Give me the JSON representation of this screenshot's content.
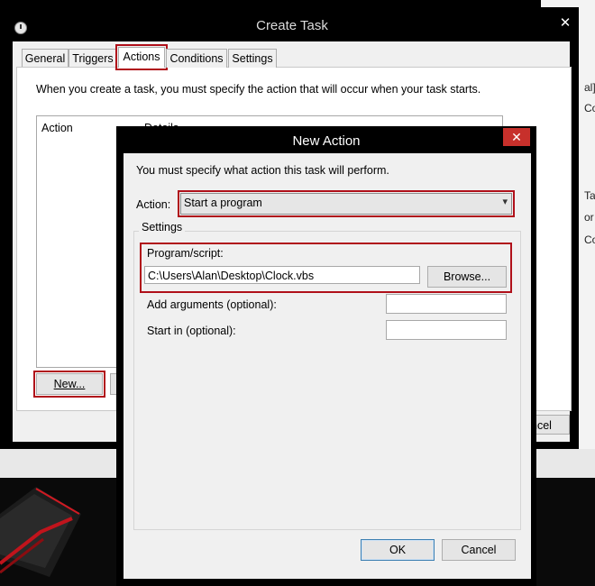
{
  "create_task": {
    "title": "Create Task",
    "close_glyph": "✕",
    "tabs": [
      {
        "label": "General"
      },
      {
        "label": "Triggers"
      },
      {
        "label": "Actions"
      },
      {
        "label": "Conditions"
      },
      {
        "label": "Settings"
      }
    ],
    "active_tab": "Actions",
    "description": "When you create a task, you must specify the action that will occur when your task starts.",
    "columns": {
      "action": "Action",
      "details": "Details"
    },
    "new_button": "New...",
    "cancel_button_partial": "ncel"
  },
  "new_action": {
    "title": "New Action",
    "close_glyph": "✕",
    "intro": "You must specify what action this task will perform.",
    "action_label": "Action:",
    "action_value": "Start a program",
    "settings_label": "Settings",
    "program_label": "Program/script:",
    "program_value": "C:\\Users\\Alan\\Desktop\\Clock.vbs",
    "browse_button": "Browse...",
    "args_label": "Add arguments (optional):",
    "args_value": "",
    "startin_label": "Start in (optional):",
    "startin_value": "",
    "ok_button": "OK",
    "cancel_button": "Cancel"
  },
  "background": {
    "fragments": [
      "al]",
      "Co",
      "Ta",
      "or",
      "Co"
    ]
  },
  "colors": {
    "highlight": "#b0101a",
    "close_red": "#c7302b",
    "dialog_bg": "#f0f0f0"
  }
}
